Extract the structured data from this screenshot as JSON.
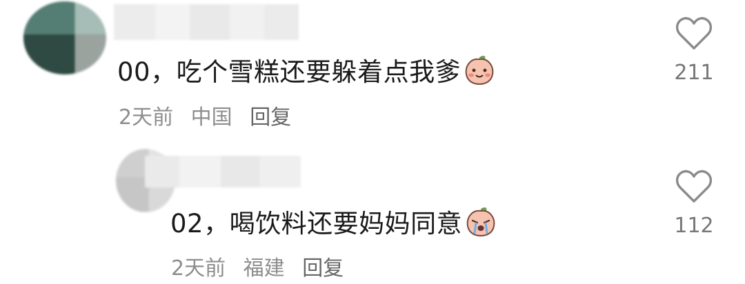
{
  "comments": [
    {
      "text": "00，吃个雪糕还要躲着点我爹",
      "emoji": "blushing-peach-emoji",
      "time": "2天前",
      "location": "中国",
      "reply": "回复",
      "likes": "211"
    },
    {
      "text": "02，喝饮料还要妈妈同意",
      "emoji": "crying-peach-emoji",
      "time": "2天前",
      "location": "福建",
      "reply": "回复",
      "likes": "112"
    }
  ],
  "icons": {
    "like": "heart-outline-icon",
    "avatar": "blurred-avatar"
  },
  "colors": {
    "text": "#1a1a1a",
    "meta": "#8d8d8d",
    "peach": "#f3b39f"
  }
}
